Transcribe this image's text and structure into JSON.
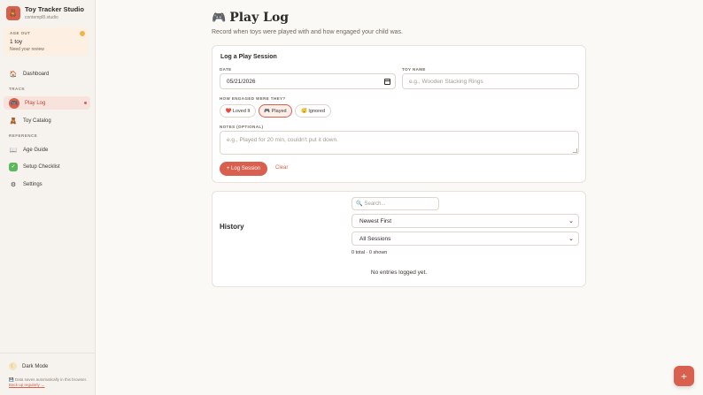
{
  "brand": {
    "title": "Toy Tracker Studio",
    "subtitle": "contempl8.studio",
    "logo_icon": "🧸"
  },
  "age_card": {
    "label": "AGE OUT",
    "count": "1 toy",
    "note": "Need your review"
  },
  "nav": {
    "dashboard": {
      "label": "Dashboard",
      "icon": "home-icon"
    },
    "track_label": "TRACK",
    "play_log": {
      "label": "Play Log",
      "icon": "gamepad-icon"
    },
    "toy_catalog": {
      "label": "Toy Catalog",
      "icon": "toy-icon"
    },
    "reference_label": "REFERENCE",
    "age_guide": {
      "label": "Age Guide",
      "icon": "book-icon"
    },
    "setup_checklist": {
      "label": "Setup Checklist",
      "icon": "checkbox-icon"
    },
    "settings": {
      "label": "Settings",
      "icon": "gear-icon"
    }
  },
  "footer": {
    "dark_mode": "Dark Mode",
    "save_note": "💾 Data saves automatically in this browser.",
    "backup_link": "Back up regularly →"
  },
  "page": {
    "title": "Play Log",
    "title_icon": "🎮",
    "subtitle": "Record when toys were played with and how engaged your child was."
  },
  "form": {
    "heading": "Log a Play Session",
    "date_label": "DATE",
    "date_value": "05/21/2026",
    "toy_label": "TOY NAME",
    "toy_placeholder": "e.g., Wooden Stacking Rings",
    "engagement_label": "HOW ENGAGED WERE THEY?",
    "chips": [
      {
        "label": "❤️ Loved It",
        "selected": false
      },
      {
        "label": "🎮 Played",
        "selected": true
      },
      {
        "label": "😴 Ignored",
        "selected": false
      }
    ],
    "notes_label": "NOTES (OPTIONAL)",
    "notes_placeholder": "e.g., Played for 20 min, couldn't put it down.",
    "submit_label": "+ Log Session",
    "clear_label": "Clear"
  },
  "history": {
    "title": "History",
    "search_placeholder": "Search...",
    "sort_value": "Newest First",
    "filter_value": "All Sessions",
    "count_text": "0 total · 0 shown",
    "empty_text": "No entries logged yet."
  },
  "fab_label": "+",
  "colors": {
    "accent": "#d9604e",
    "background": "#fbf9f6",
    "sidebar": "#f6f2ed"
  }
}
